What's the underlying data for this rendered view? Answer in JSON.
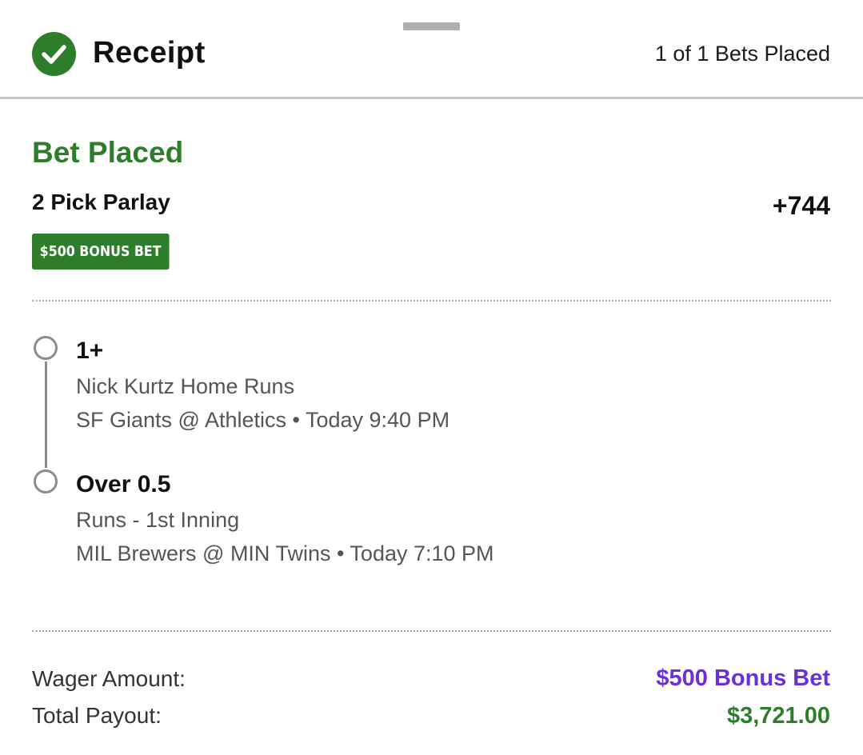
{
  "header": {
    "title": "Receipt",
    "bets_placed": "1 of 1 Bets Placed"
  },
  "bet": {
    "status": "Bet Placed",
    "type": "2 Pick Parlay",
    "odds": "+744",
    "badge": "$500 BONUS BET",
    "legs": [
      {
        "selection": "1+",
        "market": "Nick Kurtz Home Runs",
        "event": "SF Giants @ Athletics • Today 9:40 PM"
      },
      {
        "selection": "Over 0.5",
        "market": "Runs - 1st Inning",
        "event": "MIL Brewers @ MIN Twins • Today 7:10 PM"
      }
    ]
  },
  "summary": {
    "wager_label": "Wager Amount:",
    "wager_value": "$500 Bonus Bet",
    "payout_label": "Total Payout:",
    "payout_value": "$3,721.00"
  },
  "icons": {
    "status": "check-circle-icon"
  },
  "colors": {
    "success_green": "#2d7d2a",
    "bonus_purple": "#6a2fd8",
    "leg_line_gray": "#8c8c8c"
  }
}
